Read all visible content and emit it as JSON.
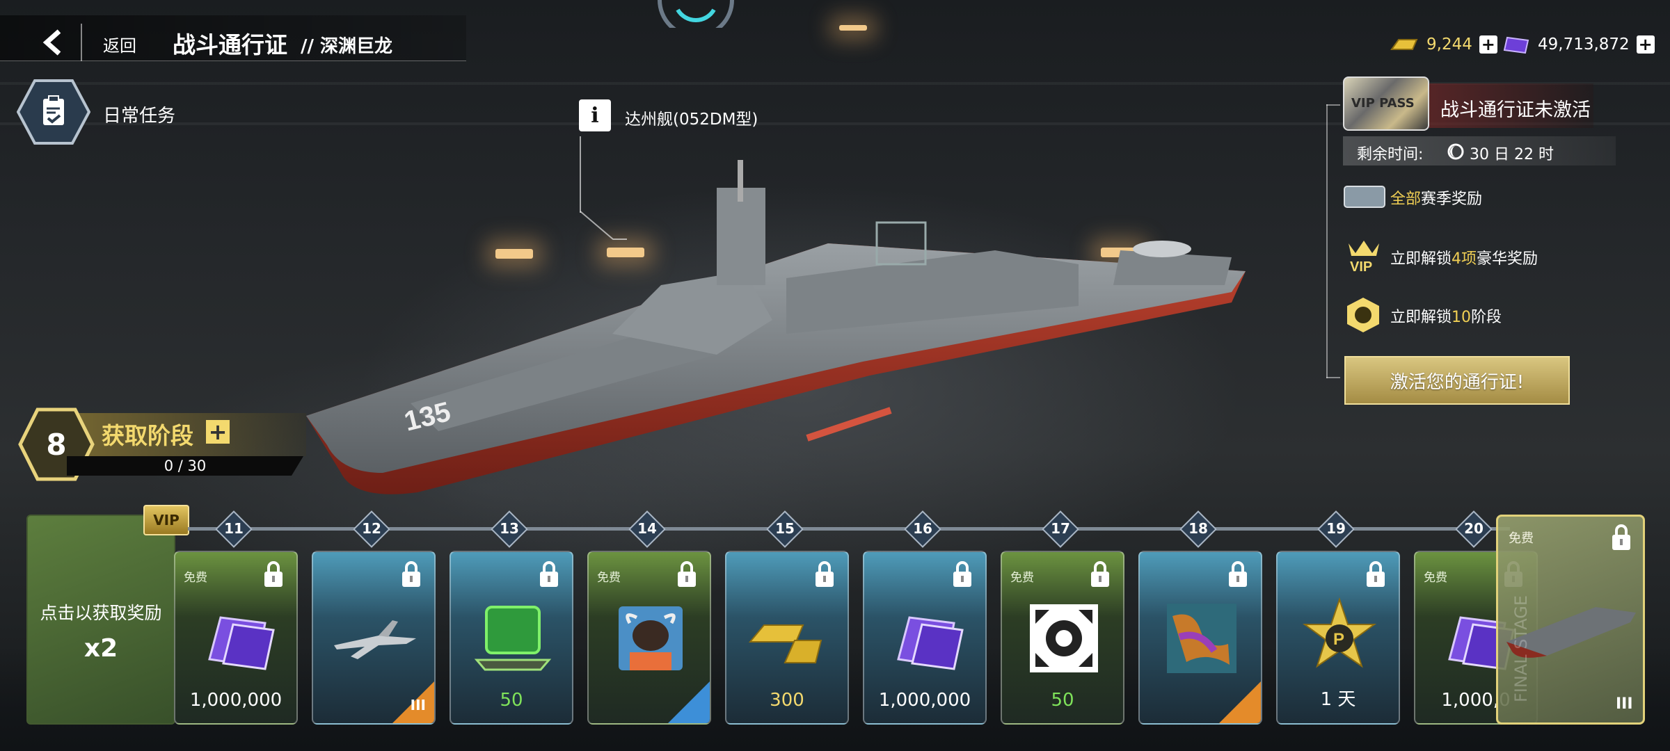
{
  "header": {
    "back_label": "返回",
    "title": "战斗通行证",
    "subtitle": "// 深渊巨龙"
  },
  "daily": {
    "label": "日常任务"
  },
  "ship": {
    "name": "达州舰(052DM型)",
    "hull_number": "135"
  },
  "currencies": [
    {
      "icon": "gold-bar-icon",
      "value": "9,244"
    },
    {
      "icon": "purple-card-icon",
      "value": "49,713,872"
    }
  ],
  "pass_panel": {
    "ticket_text": "VIP PASS",
    "status": "战斗通行证未激活",
    "remaining_label": "剩余时间:",
    "remaining_value": "30 日 22 时",
    "features": [
      {
        "icon": "pass-ticket-icon",
        "pre": "",
        "hl": "全部",
        "post": "赛季奖励"
      },
      {
        "icon": "vip-crown-icon",
        "pre": "立即解锁",
        "hl": "4项",
        "post": "豪华奖励"
      },
      {
        "icon": "level-badge-icon",
        "pre": "立即解锁",
        "hl": "10",
        "post": "阶段"
      }
    ],
    "activate_label": "激活您的通行证!"
  },
  "stage": {
    "level": "8",
    "label": "获取阶段",
    "plus": "+",
    "progress": "0 / 30",
    "progress_fraction": 0
  },
  "claim": {
    "label": "点击以获取奖励",
    "multiplier": "x2",
    "vip_tag": "VIP"
  },
  "track": {
    "nodes": [
      "11",
      "12",
      "13",
      "14",
      "15",
      "16",
      "17",
      "18",
      "19",
      "20"
    ],
    "cards": [
      {
        "node": "11",
        "style": "free",
        "free_label": "免费",
        "art": "purple-cards",
        "amount": "1,000,000",
        "amount_color": "white"
      },
      {
        "node": "12",
        "style": "blue",
        "free_label": "",
        "art": "fighter-jet",
        "amount": "",
        "tier": "III",
        "corner": "orange"
      },
      {
        "node": "13",
        "style": "blue",
        "free_label": "",
        "art": "green-chip",
        "amount": "50",
        "amount_color": "green"
      },
      {
        "node": "14",
        "style": "free",
        "free_label": "免费",
        "art": "avatar-bull",
        "amount": "",
        "corner": "blue"
      },
      {
        "node": "15",
        "style": "blue",
        "free_label": "",
        "art": "gold-bars",
        "amount": "300",
        "amount_color": "gold"
      },
      {
        "node": "16",
        "style": "blue",
        "free_label": "",
        "art": "purple-cards",
        "amount": "1,000,000",
        "amount_color": "white"
      },
      {
        "node": "17",
        "style": "free",
        "free_label": "免费",
        "art": "repair-kit",
        "amount": "50",
        "amount_color": "green"
      },
      {
        "node": "18",
        "style": "blue",
        "free_label": "",
        "art": "camo-skin",
        "amount": "",
        "corner": "orange"
      },
      {
        "node": "19",
        "style": "blue",
        "free_label": "",
        "art": "star-badge",
        "amount": "1 天",
        "amount_color": "white"
      },
      {
        "node": "20",
        "style": "free",
        "free_label": "免费",
        "art": "purple-cards",
        "amount": "1,000,0",
        "amount_color": "white"
      }
    ]
  },
  "final": {
    "free_label": "免费",
    "tier": "III",
    "watermark": "FINAL STAGE"
  },
  "colors": {
    "gold": "#f3d96e",
    "green": "#7fe25a",
    "hull_red": "#a8362a"
  }
}
